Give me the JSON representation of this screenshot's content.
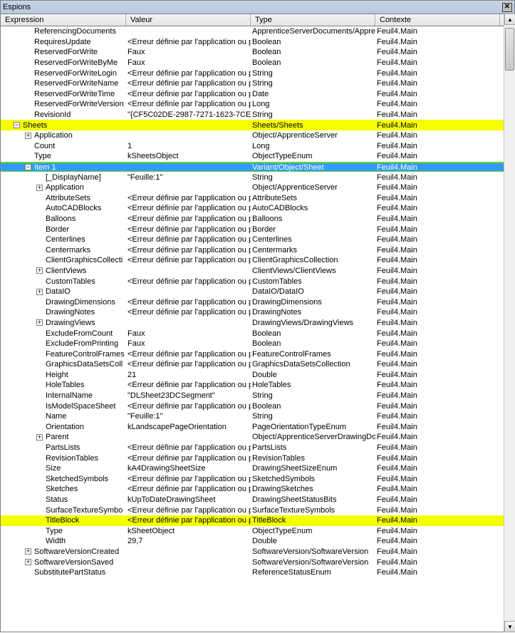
{
  "window_title": "Espions",
  "columns": {
    "expr": "Expression",
    "val": "Valeur",
    "type": "Type",
    "ctx": "Contexte"
  },
  "rows": [
    {
      "indent": 2,
      "exp": "",
      "name": "ReferencingDocuments",
      "val": "",
      "type": "ApprenticeServerDocuments/Appre",
      "ctx": "Feuil4.Main"
    },
    {
      "indent": 2,
      "exp": "",
      "name": "RequiresUpdate",
      "val": "<Erreur définie par l'application ou p",
      "type": "Boolean",
      "ctx": "Feuil4.Main"
    },
    {
      "indent": 2,
      "exp": "",
      "name": "ReservedForWrite",
      "val": "Faux",
      "type": "Boolean",
      "ctx": "Feuil4.Main"
    },
    {
      "indent": 2,
      "exp": "",
      "name": "ReservedForWriteByMe",
      "val": "Faux",
      "type": "Boolean",
      "ctx": "Feuil4.Main"
    },
    {
      "indent": 2,
      "exp": "",
      "name": "ReservedForWriteLogin",
      "val": "<Erreur définie par l'application ou p",
      "type": "String",
      "ctx": "Feuil4.Main"
    },
    {
      "indent": 2,
      "exp": "",
      "name": "ReservedForWriteName",
      "val": "<Erreur définie par l'application ou p",
      "type": "String",
      "ctx": "Feuil4.Main"
    },
    {
      "indent": 2,
      "exp": "",
      "name": "ReservedForWriteTime",
      "val": "<Erreur définie par l'application ou p",
      "type": "Date",
      "ctx": "Feuil4.Main"
    },
    {
      "indent": 2,
      "exp": "",
      "name": "ReservedForWriteVersion",
      "val": "<Erreur définie par l'application ou p",
      "type": "Long",
      "ctx": "Feuil4.Main"
    },
    {
      "indent": 2,
      "exp": "",
      "name": "RevisionId",
      "val": "\"{CF5C02DE-2987-7271-1623-7CE9",
      "type": "String",
      "ctx": "Feuil4.Main"
    },
    {
      "indent": 1,
      "exp": "minus",
      "name": "Sheets",
      "val": "",
      "type": "Sheets/Sheets",
      "ctx": "Feuil4.Main",
      "hl": "yellow"
    },
    {
      "indent": 2,
      "exp": "plus",
      "name": "Application",
      "val": "",
      "type": "Object/ApprenticeServer",
      "ctx": "Feuil4.Main"
    },
    {
      "indent": 2,
      "exp": "",
      "name": "Count",
      "val": "1",
      "type": "Long",
      "ctx": "Feuil4.Main"
    },
    {
      "indent": 2,
      "exp": "",
      "name": "Type",
      "val": "kSheetsObject",
      "type": "ObjectTypeEnum",
      "ctx": "Feuil4.Main"
    },
    {
      "indent": 2,
      "exp": "minus",
      "name": "Item 1",
      "val": "",
      "type": "Variant/Object/Sheet",
      "ctx": "Feuil4.Main",
      "hl": "green",
      "selected": true
    },
    {
      "indent": 3,
      "exp": "",
      "name": "[_DisplayName]",
      "val": "\"Feuille:1\"",
      "type": "String",
      "ctx": "Feuil4.Main"
    },
    {
      "indent": 3,
      "exp": "plus",
      "name": "Application",
      "val": "",
      "type": "Object/ApprenticeServer",
      "ctx": "Feuil4.Main"
    },
    {
      "indent": 3,
      "exp": "",
      "name": "AttributeSets",
      "val": "<Erreur définie par l'application ou p",
      "type": "AttributeSets",
      "ctx": "Feuil4.Main"
    },
    {
      "indent": 3,
      "exp": "",
      "name": "AutoCADBlocks",
      "val": "<Erreur définie par l'application ou p",
      "type": "AutoCADBlocks",
      "ctx": "Feuil4.Main"
    },
    {
      "indent": 3,
      "exp": "",
      "name": "Balloons",
      "val": "<Erreur définie par l'application ou p",
      "type": "Balloons",
      "ctx": "Feuil4.Main"
    },
    {
      "indent": 3,
      "exp": "",
      "name": "Border",
      "val": "<Erreur définie par l'application ou p",
      "type": "Border",
      "ctx": "Feuil4.Main"
    },
    {
      "indent": 3,
      "exp": "",
      "name": "Centerlines",
      "val": "<Erreur définie par l'application ou p",
      "type": "Centerlines",
      "ctx": "Feuil4.Main"
    },
    {
      "indent": 3,
      "exp": "",
      "name": "Centermarks",
      "val": "<Erreur définie par l'application ou p",
      "type": "Centermarks",
      "ctx": "Feuil4.Main"
    },
    {
      "indent": 3,
      "exp": "",
      "name": "ClientGraphicsCollecti",
      "val": "<Erreur définie par l'application ou p",
      "type": "ClientGraphicsCollection",
      "ctx": "Feuil4.Main"
    },
    {
      "indent": 3,
      "exp": "plus",
      "name": "ClientViews",
      "val": "",
      "type": "ClientViews/ClientViews",
      "ctx": "Feuil4.Main"
    },
    {
      "indent": 3,
      "exp": "",
      "name": "CustomTables",
      "val": "<Erreur définie par l'application ou p",
      "type": "CustomTables",
      "ctx": "Feuil4.Main"
    },
    {
      "indent": 3,
      "exp": "plus",
      "name": "DataIO",
      "val": "",
      "type": "DataIO/DataIO",
      "ctx": "Feuil4.Main"
    },
    {
      "indent": 3,
      "exp": "",
      "name": "DrawingDimensions",
      "val": "<Erreur définie par l'application ou p",
      "type": "DrawingDimensions",
      "ctx": "Feuil4.Main"
    },
    {
      "indent": 3,
      "exp": "",
      "name": "DrawingNotes",
      "val": "<Erreur définie par l'application ou p",
      "type": "DrawingNotes",
      "ctx": "Feuil4.Main"
    },
    {
      "indent": 3,
      "exp": "plus",
      "name": "DrawingViews",
      "val": "",
      "type": "DrawingViews/DrawingViews",
      "ctx": "Feuil4.Main"
    },
    {
      "indent": 3,
      "exp": "",
      "name": "ExcludeFromCount",
      "val": "Faux",
      "type": "Boolean",
      "ctx": "Feuil4.Main"
    },
    {
      "indent": 3,
      "exp": "",
      "name": "ExcludeFromPrinting",
      "val": "Faux",
      "type": "Boolean",
      "ctx": "Feuil4.Main"
    },
    {
      "indent": 3,
      "exp": "",
      "name": "FeatureControlFrames",
      "val": "<Erreur définie par l'application ou p",
      "type": "FeatureControlFrames",
      "ctx": "Feuil4.Main"
    },
    {
      "indent": 3,
      "exp": "",
      "name": "GraphicsDataSetsColl",
      "val": "<Erreur définie par l'application ou p",
      "type": "GraphicsDataSetsCollection",
      "ctx": "Feuil4.Main"
    },
    {
      "indent": 3,
      "exp": "",
      "name": "Height",
      "val": "21",
      "type": "Double",
      "ctx": "Feuil4.Main"
    },
    {
      "indent": 3,
      "exp": "",
      "name": "HoleTables",
      "val": "<Erreur définie par l'application ou p",
      "type": "HoleTables",
      "ctx": "Feuil4.Main"
    },
    {
      "indent": 3,
      "exp": "",
      "name": "InternalName",
      "val": "\"DLSheet23DCSegment\"",
      "type": "String",
      "ctx": "Feuil4.Main"
    },
    {
      "indent": 3,
      "exp": "",
      "name": "IsModelSpaceSheet",
      "val": "<Erreur définie par l'application ou p",
      "type": "Boolean",
      "ctx": "Feuil4.Main"
    },
    {
      "indent": 3,
      "exp": "",
      "name": "Name",
      "val": "\"Feuille:1\"",
      "type": "String",
      "ctx": "Feuil4.Main"
    },
    {
      "indent": 3,
      "exp": "",
      "name": "Orientation",
      "val": "kLandscapePageOrientation",
      "type": "PageOrientationTypeEnum",
      "ctx": "Feuil4.Main"
    },
    {
      "indent": 3,
      "exp": "plus",
      "name": "Parent",
      "val": "",
      "type": "Object/ApprenticeServerDrawingDo",
      "ctx": "Feuil4.Main"
    },
    {
      "indent": 3,
      "exp": "",
      "name": "PartsLists",
      "val": "<Erreur définie par l'application ou p",
      "type": "PartsLists",
      "ctx": "Feuil4.Main"
    },
    {
      "indent": 3,
      "exp": "",
      "name": "RevisionTables",
      "val": "<Erreur définie par l'application ou p",
      "type": "RevisionTables",
      "ctx": "Feuil4.Main"
    },
    {
      "indent": 3,
      "exp": "",
      "name": "Size",
      "val": "kA4DrawingSheetSize",
      "type": "DrawingSheetSizeEnum",
      "ctx": "Feuil4.Main"
    },
    {
      "indent": 3,
      "exp": "",
      "name": "SketchedSymbols",
      "val": "<Erreur définie par l'application ou p",
      "type": "SketchedSymbols",
      "ctx": "Feuil4.Main"
    },
    {
      "indent": 3,
      "exp": "",
      "name": "Sketches",
      "val": "<Erreur définie par l'application ou p",
      "type": "DrawingSketches",
      "ctx": "Feuil4.Main"
    },
    {
      "indent": 3,
      "exp": "",
      "name": "Status",
      "val": "kUpToDateDrawingSheet",
      "type": "DrawingSheetStatusBits",
      "ctx": "Feuil4.Main"
    },
    {
      "indent": 3,
      "exp": "",
      "name": "SurfaceTextureSymbo",
      "val": "<Erreur définie par l'application ou p",
      "type": "SurfaceTextureSymbols",
      "ctx": "Feuil4.Main"
    },
    {
      "indent": 3,
      "exp": "",
      "name": "TitleBlock",
      "val": "<Erreur définie par l'application ou p",
      "type": "TitleBlock",
      "ctx": "Feuil4.Main",
      "hl": "yellow"
    },
    {
      "indent": 3,
      "exp": "",
      "name": "Type",
      "val": "kSheetObject",
      "type": "ObjectTypeEnum",
      "ctx": "Feuil4.Main"
    },
    {
      "indent": 3,
      "exp": "",
      "name": "Width",
      "val": "29,7",
      "type": "Double",
      "ctx": "Feuil4.Main"
    },
    {
      "indent": 2,
      "exp": "plus",
      "name": "SoftwareVersionCreated",
      "val": "",
      "type": "SoftwareVersion/SoftwareVersion",
      "ctx": "Feuil4.Main"
    },
    {
      "indent": 2,
      "exp": "plus",
      "name": "SoftwareVersionSaved",
      "val": "",
      "type": "SoftwareVersion/SoftwareVersion",
      "ctx": "Feuil4.Main"
    },
    {
      "indent": 2,
      "exp": "",
      "name": "SubstitutePartStatus",
      "val": "",
      "type": "ReferenceStatusEnum",
      "ctx": "Feuil4.Main"
    }
  ]
}
